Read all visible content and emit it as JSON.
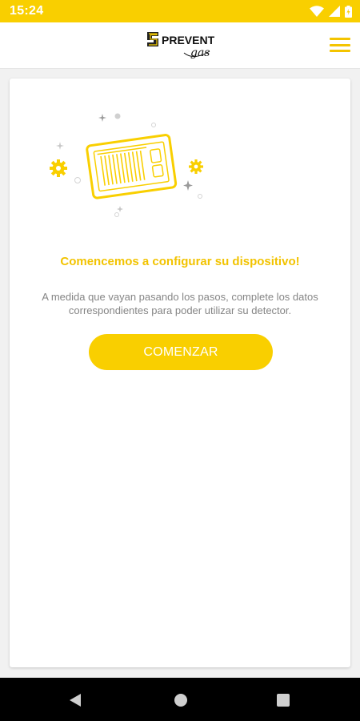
{
  "status_bar": {
    "time": "15:24",
    "icons": [
      "wifi-icon",
      "signal-icon",
      "battery-icon"
    ]
  },
  "header": {
    "logo_text": "PREVENT",
    "logo_subtext": "gas",
    "icons": [
      "logo",
      "hamburger-menu-icon"
    ]
  },
  "main": {
    "heading": "Comencemos a configurar su dispositivo!",
    "description": "A medida que vayan pasando los pasos, complete los datos correspondientes para poder utilizar su detector.",
    "start_button_label": "COMENZAR"
  },
  "nav_bar": {
    "icons": [
      "back-icon",
      "home-icon",
      "recents-icon"
    ]
  },
  "colors": {
    "accent": "#f9cf00",
    "heading": "#f2c300",
    "text_muted": "#858585",
    "background": "#f1f1f1",
    "card": "#ffffff",
    "nav_bar": "#000000"
  }
}
